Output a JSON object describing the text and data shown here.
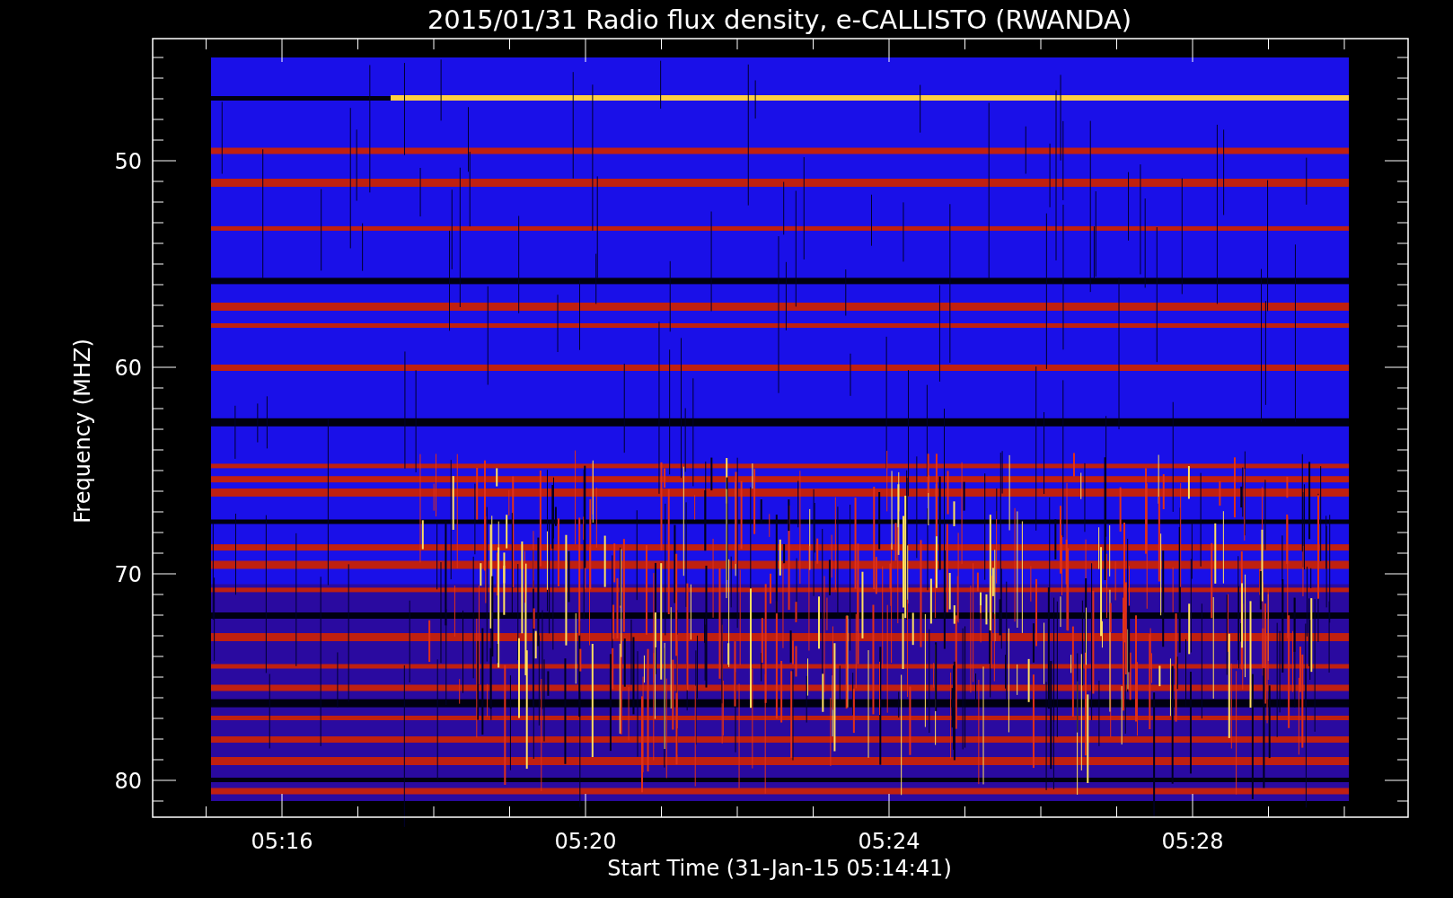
{
  "chart": {
    "title": "2015/01/31  Radio flux density, e-CALLISTO (RWANDA)",
    "y_axis": {
      "label": "Frequency (MHZ)",
      "ticks": [
        "50",
        "60",
        "70",
        "80"
      ]
    },
    "x_axis": {
      "label": "Start Time (31-Jan-15 05:14:41)",
      "ticks": [
        "05:16",
        "05:20",
        "05:24",
        "05:28"
      ]
    }
  }
}
